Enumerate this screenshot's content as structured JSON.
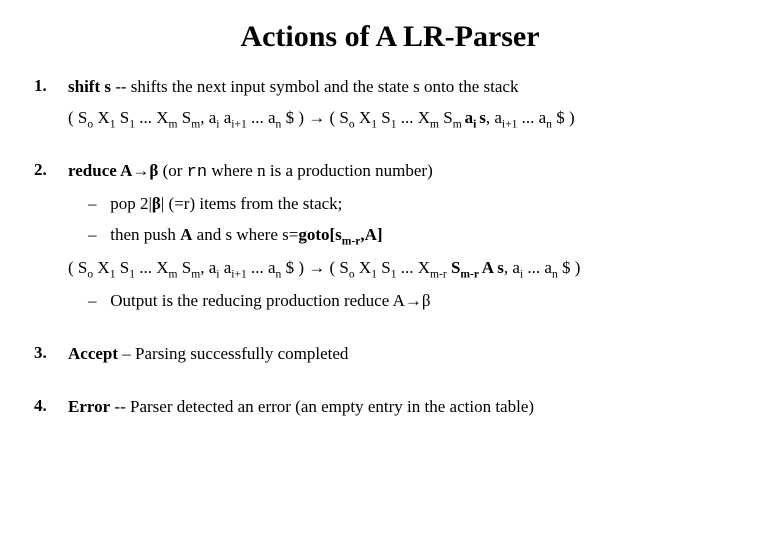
{
  "title": "Actions of A LR-Parser",
  "items": [
    {
      "num": "1.",
      "lead_label": "shift s",
      "lead_rest": "  -- shifts the next input symbol and the state s onto the stack",
      "stack_before_plain": "( S",
      "s0": "o",
      "x1": " X",
      "x1sub": "1",
      "s1": " S",
      "s1sub": "1",
      "dots1": " ... X",
      "xmsub": "m",
      "sm": " S",
      "smsub": "m",
      "comma_a": ", a",
      "aisub": "i",
      "aip1": " a",
      "aip1sub": "i+1",
      "dots2": " ... a",
      "ansub": "n",
      "close1": " $ )  ",
      "arrow": "→",
      "open2": "  ( S",
      "s0b": "o",
      "x1b": " X",
      "x1bsub": "1",
      "s1b": " S",
      "s1bsub": "1",
      "dots1b": " ... X",
      "xmbsub": "m",
      "smb": " S",
      "smbsub": "m ",
      "aib": "a",
      "aibsub": "i ",
      "sbold": "s",
      "aip1b": ", a",
      "aip1bsub": "i+1",
      "dots2b": " ... a",
      "anbsub": "n",
      "close2": " $ )"
    },
    {
      "num": "2.",
      "lead_pre": "reduce ",
      "lead_bold": "A→β",
      "lead_post1": "   (or ",
      "lead_tt": "rn",
      "lead_post2": " where n is a production number)",
      "sub1_pre": "pop 2|",
      "sub1_beta": "β",
      "sub1_post": "|  (=r) items from the stack;",
      "sub2_pre": "then push ",
      "sub2_A": "A",
      "sub2_mid": " and  s  where  s=",
      "sub2_goto": "goto[s",
      "sub2_gotosub": "m-r",
      "sub2_goto_close": ",A]",
      "stk_open": "( S",
      "stk_s0": "o",
      "stk_x1": " X",
      "stk_x1s": "1",
      "stk_s1": " S",
      "stk_s1s": "1",
      "stk_dots": " ... X",
      "stk_xms": "m",
      "stk_sm": " S",
      "stk_sms": "m",
      "stk_ai": ", a",
      "stk_ais": "i",
      "stk_aip1": " a",
      "stk_aip1s": "i+1",
      "stk_an": " ... a",
      "stk_ans": "n",
      "stk_close": " $ )  ",
      "stk_arrow": "→",
      "stk_open2": "  ( S",
      "stk_s0b": "o",
      "stk_x1b": " X",
      "stk_x1bs": "1",
      "stk_s1b": " S",
      "stk_s1bs": "1",
      "stk_dotsb": " ... X",
      "stk_xmrbs": "m-r",
      "stk_smrb": " S",
      "stk_smrbsub": "m-r ",
      "stk_Abold": "A  s",
      "stk_aib": ", a",
      "stk_aibs": "i",
      "stk_anb": " ... a",
      "stk_anbs": "n",
      "stk_close2": " $ )",
      "out_pre": "Output is the reducing production reduce A→β"
    },
    {
      "num": "3.",
      "label": "Accept",
      "rest": " – Parsing successfully completed"
    },
    {
      "num": "4.",
      "label": "Error",
      "rest": "  -- Parser detected an error (an empty entry in the action table)"
    }
  ]
}
